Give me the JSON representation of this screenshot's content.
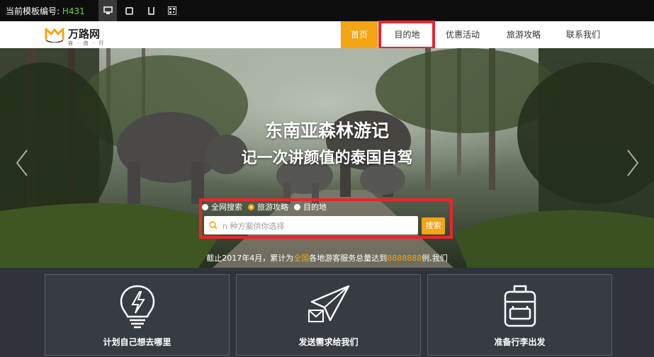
{
  "preview_bar": {
    "label": "当前模板编号:",
    "code": "H431",
    "devices": [
      "desktop-icon",
      "tablet-icon",
      "mobile-icon",
      "qrcode-icon"
    ]
  },
  "logo": {
    "name": "万路网",
    "subtitle": "自 · 由 · 行"
  },
  "nav": {
    "items": [
      {
        "label": "首页",
        "active": true
      },
      {
        "label": "目的地",
        "active": false
      },
      {
        "label": "优惠活动",
        "active": false
      },
      {
        "label": "旅游攻略",
        "active": false
      },
      {
        "label": "联系我们",
        "active": false
      }
    ]
  },
  "hero": {
    "title": "东南亚森林游记",
    "subtitle": "记一次讲颜值的泰国自驾"
  },
  "search": {
    "options": [
      "全网搜索",
      "旅游攻略",
      "目的地"
    ],
    "selected": "旅游攻略",
    "placeholder": "n  种方案供你选择",
    "button": "搜索"
  },
  "stats": {
    "prefix": "截止2017年4月，累计为",
    "highlight_1": "全国",
    "middle": "各地游客服务总量达到",
    "highlight_2": "8888888",
    "suffix": "例,我们"
  },
  "features": [
    {
      "label": "计划自己想去哪里",
      "icon": "lightbulb-icon"
    },
    {
      "label": "发送需求给我们",
      "icon": "paper-plane-icon"
    },
    {
      "label": "准备行李出发",
      "icon": "backpack-icon"
    }
  ],
  "colors": {
    "accent": "#f5a413",
    "highlight": "#e8262b",
    "code": "#7bd32a"
  }
}
